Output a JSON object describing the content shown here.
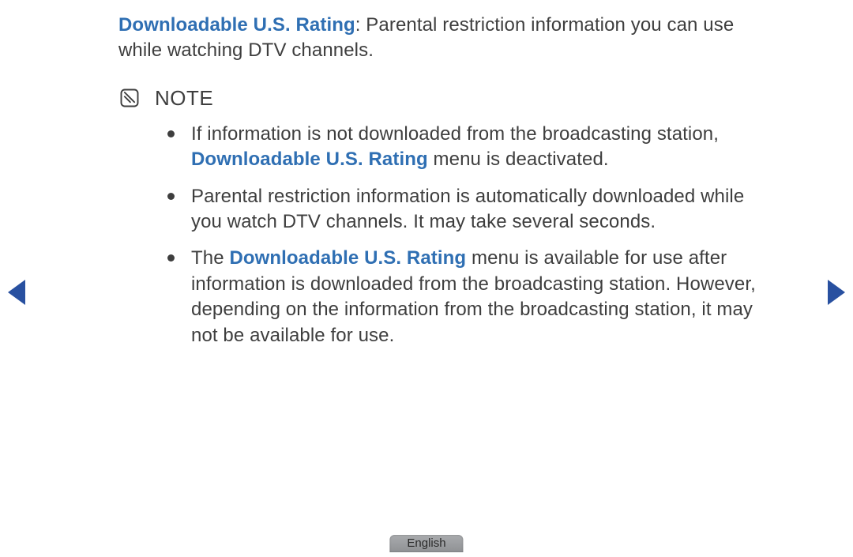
{
  "intro": {
    "highlight": "Downloadable U.S. Rating",
    "rest": ": Parental restriction information you can use while watching DTV channels."
  },
  "note_label": "NOTE",
  "bullets": {
    "b1": {
      "pre": "If information is not downloaded from the broadcasting station, ",
      "highlight": "Downloadable U.S. Rating",
      "post": " menu is deactivated."
    },
    "b2": "Parental restriction information is automatically downloaded while you watch DTV channels. It may take several seconds.",
    "b3": {
      "pre": "The ",
      "highlight": "Downloadable U.S. Rating",
      "post": " menu is available for use after information is downloaded from the broadcasting station. However, depending on the information from the broadcasting station, it may not be available for use."
    }
  },
  "language": "English"
}
